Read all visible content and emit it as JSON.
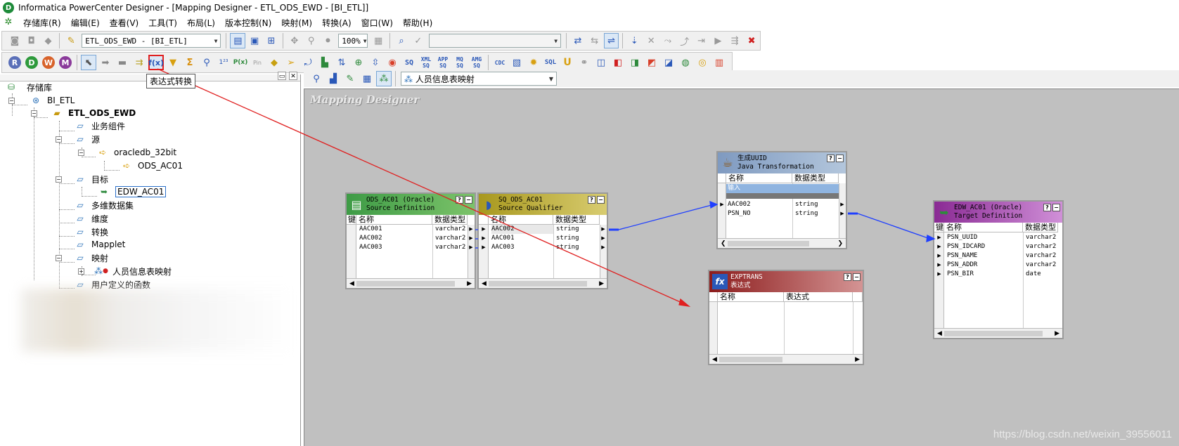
{
  "window": {
    "title": "Informatica PowerCenter Designer - [Mapping Designer - ETL_ODS_EWD - [BI_ETL]]",
    "app_icon": "D"
  },
  "menu": [
    "存储库(R)",
    "编辑(E)",
    "查看(V)",
    "工具(T)",
    "布局(L)",
    "版本控制(N)",
    "映射(M)",
    "转换(A)",
    "窗口(W)",
    "帮助(H)"
  ],
  "toolbar": {
    "folder_combo": "ETL_ODS_EWD - [BI_ETL]",
    "zoom": "100%",
    "client_buttons": [
      "R",
      "D",
      "W",
      "M"
    ],
    "expression_button": "f(x)",
    "tooltip": "表达式转换",
    "text_icons": [
      "SQ",
      "XML SQ",
      "APP SQ",
      "MQ SQ",
      "AMG SQ",
      "CDC",
      "SQL",
      "U"
    ]
  },
  "navigator": {
    "root": "存储库",
    "repo": "BI_ETL",
    "folder": "ETL_ODS_EWD",
    "nodes": {
      "business_components": "业务组件",
      "sources": "源",
      "source_db": "oracledb_32bit",
      "source_table": "ODS_AC01",
      "targets": "目标",
      "target_table": "EDW_AC01",
      "cubes": "多维数据集",
      "dimensions": "维度",
      "transformations": "转换",
      "mapplets": "Mapplet",
      "mappings": "映射",
      "mapping_item": "人员信息表映射",
      "udf": "用户定义的函数"
    }
  },
  "workspace": {
    "mapping_combo": "人员信息表映射",
    "title": "Mapping Designer",
    "watermark": "https://blog.csdn.net/weixin_39556011"
  },
  "source_def": {
    "title1": "ODS_AC01 (Oracle)",
    "title2": "Source Definition",
    "col_key": "键",
    "col_name": "名称",
    "col_type": "数据类型",
    "rows": [
      {
        "name": "AAC001",
        "type": "varchar2"
      },
      {
        "name": "AAC002",
        "type": "varchar2"
      },
      {
        "name": "AAC003",
        "type": "varchar2"
      }
    ],
    "color": "#4caf50"
  },
  "source_qualifier": {
    "title1": "SQ_ODS_AC01",
    "title2": "Source Qualifier",
    "col_name": "名称",
    "col_type": "数据类型",
    "rows": [
      {
        "name": "AAC002",
        "type": "string"
      },
      {
        "name": "AAC001",
        "type": "string"
      },
      {
        "name": "AAC003",
        "type": "string"
      }
    ],
    "color": "#b8a82a"
  },
  "java_trans": {
    "title1": "生成UUID",
    "title2": "Java Transformation",
    "col_name": "名称",
    "col_type": "数据类型",
    "group_row": "输入",
    "rows": [
      {
        "name": "AAC002",
        "type": "string"
      },
      {
        "name": "PSN_NO",
        "type": "string"
      }
    ],
    "color": "#8fa8c8"
  },
  "exp_trans": {
    "title1": "EXPTRANS",
    "title2": "表达式",
    "col_name": "名称",
    "col_expr": "表达式",
    "color": "#a02828"
  },
  "target_def": {
    "title1": "EDW_AC01 (Oracle)",
    "title2": "Target Definition",
    "col_key": "键",
    "col_name": "名称",
    "col_type": "数据类型",
    "rows": [
      {
        "name": "PSN_UUID",
        "type": "varchar2"
      },
      {
        "name": "PSN_IDCARD",
        "type": "varchar2"
      },
      {
        "name": "PSN_NAME",
        "type": "varchar2"
      },
      {
        "name": "PSN_ADDR",
        "type": "varchar2"
      },
      {
        "name": "PSN_BIR",
        "type": "date"
      }
    ],
    "color": "#a040a8"
  }
}
